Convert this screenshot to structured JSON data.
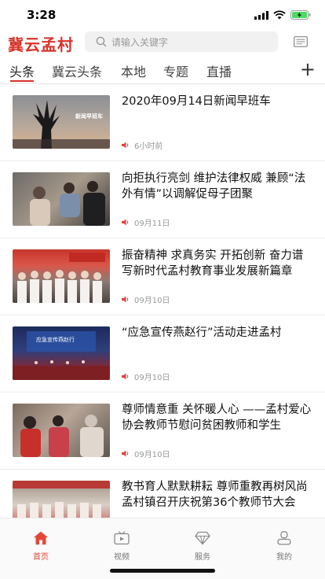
{
  "status_bar": {
    "time": "3:28"
  },
  "header": {
    "logo_text": "冀云孟村",
    "search_placeholder": "请输入关键字",
    "accent_color": "#d8332a"
  },
  "tabs": [
    {
      "label": "头条",
      "active": true
    },
    {
      "label": "冀云头条",
      "active": false
    },
    {
      "label": "本地",
      "active": false
    },
    {
      "label": "专题",
      "active": false
    },
    {
      "label": "直播",
      "active": false
    }
  ],
  "news": [
    {
      "title": "2020年09月14日新闻早班车",
      "time": "6小时前",
      "thumb_text": "新闻早班车"
    },
    {
      "title": "向拒执行亮剑 维护法律权威 兼顾“法外有情”以调解促母子团聚",
      "time": "09月11日"
    },
    {
      "title": "振奋精神 求真务实 开拓创新 奋力谱写新时代孟村教育事业发展新篇章",
      "time": "09月10日"
    },
    {
      "title": "“应急宣传燕赵行”活动走进孟村",
      "time": "09月10日",
      "thumb_text": "应急宣传燕赵行"
    },
    {
      "title": "尊师情意重 关怀暖人心 ——孟村爱心协会教师节慰问贫困教师和学生",
      "time": "09月10日"
    },
    {
      "title": "教书育人默默耕耘 尊师重教再树风尚 孟村镇召开庆祝第36个教师节大会",
      "time": ""
    }
  ],
  "bottom_nav": [
    {
      "label": "首页",
      "icon": "home-icon",
      "active": true
    },
    {
      "label": "视频",
      "icon": "tv-icon",
      "active": false
    },
    {
      "label": "服务",
      "icon": "diamond-icon",
      "active": false
    },
    {
      "label": "我的",
      "icon": "user-icon",
      "active": false
    }
  ]
}
